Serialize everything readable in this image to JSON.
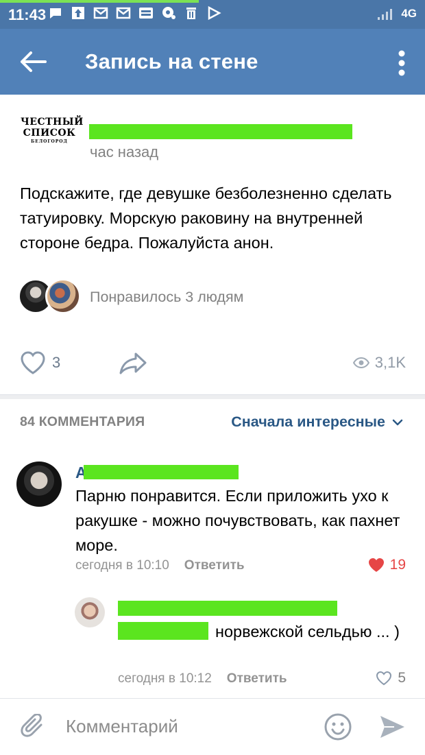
{
  "status_bar": {
    "time": "11:43",
    "network": "4G",
    "icons": [
      "message-icon",
      "upload-icon",
      "mail-icon",
      "mail-icon",
      "app-icon",
      "chat-icon",
      "trash-icon",
      "play-icon"
    ]
  },
  "app_bar": {
    "title": "Запись на стене"
  },
  "post": {
    "author_logo": {
      "line1": "ЧЕСТНЫЙ",
      "line2": "СПИСОК",
      "line3": "БЕЛОГОРОД"
    },
    "time": "час назад",
    "text": "Подскажите, где девушке безболезненно сделать татуировку. Морскую раковину на внутренней стороне бедра. Пожалуйста анон.",
    "liked_by": "Понравилось 3 людям",
    "likes_count": "3",
    "views": "3,1K"
  },
  "comments_header": {
    "count_label": "84 КОММЕНТАРИЯ",
    "sort_label": "Сначала интересные"
  },
  "comments": [
    {
      "name_initial": "А",
      "text": "Парню понравится. Если приложить ухо к ракушке - можно почувствовать, как пахнет море.",
      "time": "сегодня в 10:10",
      "reply_label": "Ответить",
      "likes": "19",
      "liked": true
    },
    {
      "text_after_redaction": "норвежской сельдью ... )",
      "time": "сегодня в 10:12",
      "reply_label": "Ответить",
      "likes": "5",
      "liked": false
    }
  ],
  "composer": {
    "placeholder": "Комментарий"
  },
  "colors": {
    "header": "#5181b8",
    "status_bar": "#4a76a8",
    "link": "#2a5885",
    "redaction": "#5be51f",
    "like_active": "#e64646"
  }
}
